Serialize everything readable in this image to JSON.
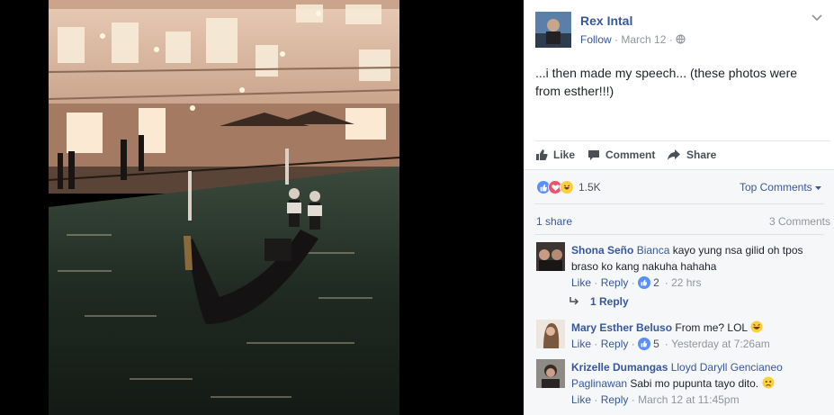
{
  "photo": {
    "description_colors": {
      "water": "#1e2a24",
      "building": "#d9b9a2"
    }
  },
  "post": {
    "author": "Rex Intal",
    "follow_label": "Follow",
    "separator": "·",
    "date": "March 12",
    "separator2": "·",
    "text": "...i then made my speech... (these photos were from esther!!!)"
  },
  "actions": {
    "like": "Like",
    "comment": "Comment",
    "share": "Share"
  },
  "feedback": {
    "reaction_count": "1.5K",
    "top_comments": "Top Comments",
    "shares": "1 share",
    "comments_count": "3 Comments"
  },
  "comments": [
    {
      "name": "Shona Seño",
      "tag": "Bianca",
      "text": " kayo yung nsa gilid oh tpos braso ko kang nakuha hahaha",
      "like": "Like",
      "reply": "Reply",
      "sep": "·",
      "likes": "2",
      "time": "22 hrs",
      "replies_label": "1 Reply"
    },
    {
      "name": "Mary Esther Beluso",
      "tag": "",
      "text": " From me? LOL",
      "like": "Like",
      "reply": "Reply",
      "sep": "·",
      "likes": "5",
      "time": "Yesterday at 7:26am"
    },
    {
      "name": "Krizelle Dumangas",
      "tag": "Lloyd Daryll Gencianeo Paglinawan",
      "text": " Sabi mo pupunta tayo dito.",
      "like": "Like",
      "reply": "Reply",
      "sep": "·",
      "time": "March 12 at 11:45pm"
    }
  ],
  "colors": {
    "link": "#365899",
    "meta": "#90949c",
    "text": "#1d2129",
    "like_blue": "#5890ff",
    "love_red": "#f25268",
    "haha_yellow": "#fccf3d"
  }
}
